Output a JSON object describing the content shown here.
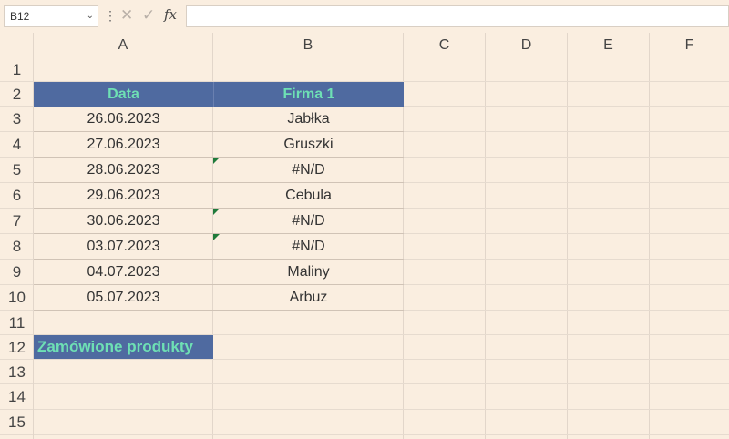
{
  "formula_bar": {
    "name_box": "B12",
    "name_box_chevron": "⌄",
    "separator": "⋮",
    "cancel_icon": "✕",
    "confirm_icon": "✓",
    "fx_label": "fx",
    "value": ""
  },
  "columns": [
    "A",
    "B",
    "C",
    "D",
    "E",
    "F"
  ],
  "rows": [
    "1",
    "2",
    "3",
    "4",
    "5",
    "6",
    "7",
    "8",
    "9",
    "10",
    "11",
    "12",
    "13",
    "14",
    "15"
  ],
  "table": {
    "header": {
      "a": "Data",
      "b": "Firma 1"
    },
    "rows": [
      {
        "a": "26.06.2023",
        "b": "Jabłka"
      },
      {
        "a": "27.06.2023",
        "b": "Gruszki"
      },
      {
        "a": "28.06.2023",
        "b": "#N/D"
      },
      {
        "a": "29.06.2023",
        "b": "Cebula"
      },
      {
        "a": "30.06.2023",
        "b": "#N/D"
      },
      {
        "a": "03.07.2023",
        "b": "#N/D"
      },
      {
        "a": "04.07.2023",
        "b": "Maliny"
      },
      {
        "a": "05.07.2023",
        "b": "Arbuz"
      }
    ]
  },
  "a12": "Zamówione produkty",
  "colors": {
    "header_fill": "#4f6aa0",
    "header_text": "#6ee0b4",
    "error_indicator": "#1f7a3a"
  }
}
